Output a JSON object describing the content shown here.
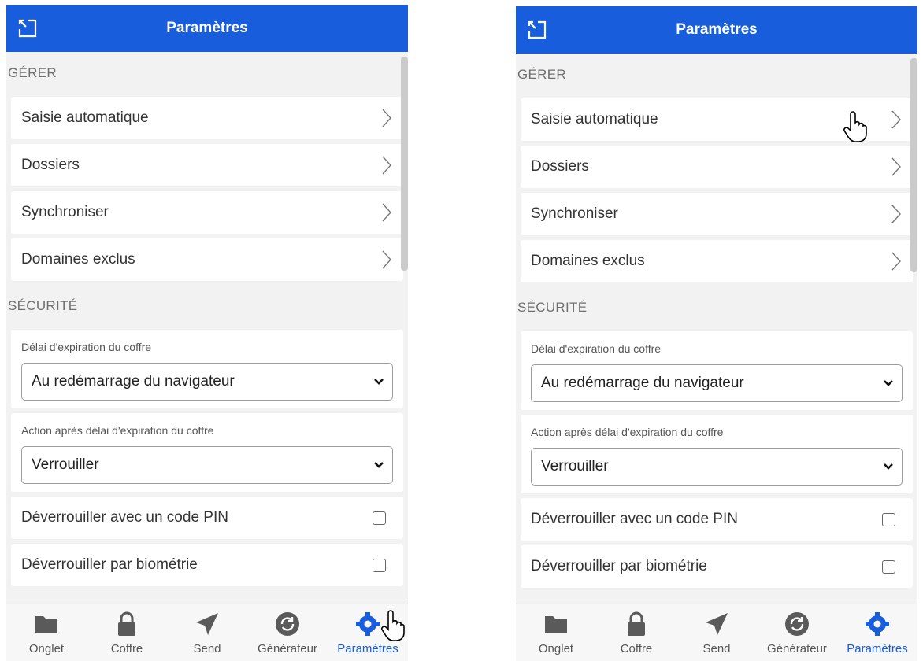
{
  "header": {
    "title": "Paramètres"
  },
  "sections": {
    "manage": {
      "title": "GÉRER",
      "items": [
        "Saisie automatique",
        "Dossiers",
        "Synchroniser",
        "Domaines exclus"
      ]
    },
    "security": {
      "title": "SÉCURITÉ",
      "vault_timeout": {
        "label": "Délai d'expiration du coffre",
        "value": "Au redémarrage du navigateur"
      },
      "timeout_action": {
        "label": "Action après délai d'expiration du coffre",
        "value": "Verrouiller"
      },
      "pin": {
        "label": "Déverrouiller avec un code PIN",
        "checked": false
      },
      "biometrics": {
        "label": "Déverrouiller par biométrie",
        "checked": false
      }
    }
  },
  "tabs": [
    {
      "label": "Onglet",
      "icon": "folder-icon"
    },
    {
      "label": "Coffre",
      "icon": "lock-icon"
    },
    {
      "label": "Send",
      "icon": "paper-plane-icon"
    },
    {
      "label": "Générateur",
      "icon": "refresh-icon"
    },
    {
      "label": "Paramètres",
      "icon": "gear-icon",
      "active": true
    }
  ],
  "colors": {
    "brand": "#175ddc",
    "background": "#f2f2f2"
  }
}
